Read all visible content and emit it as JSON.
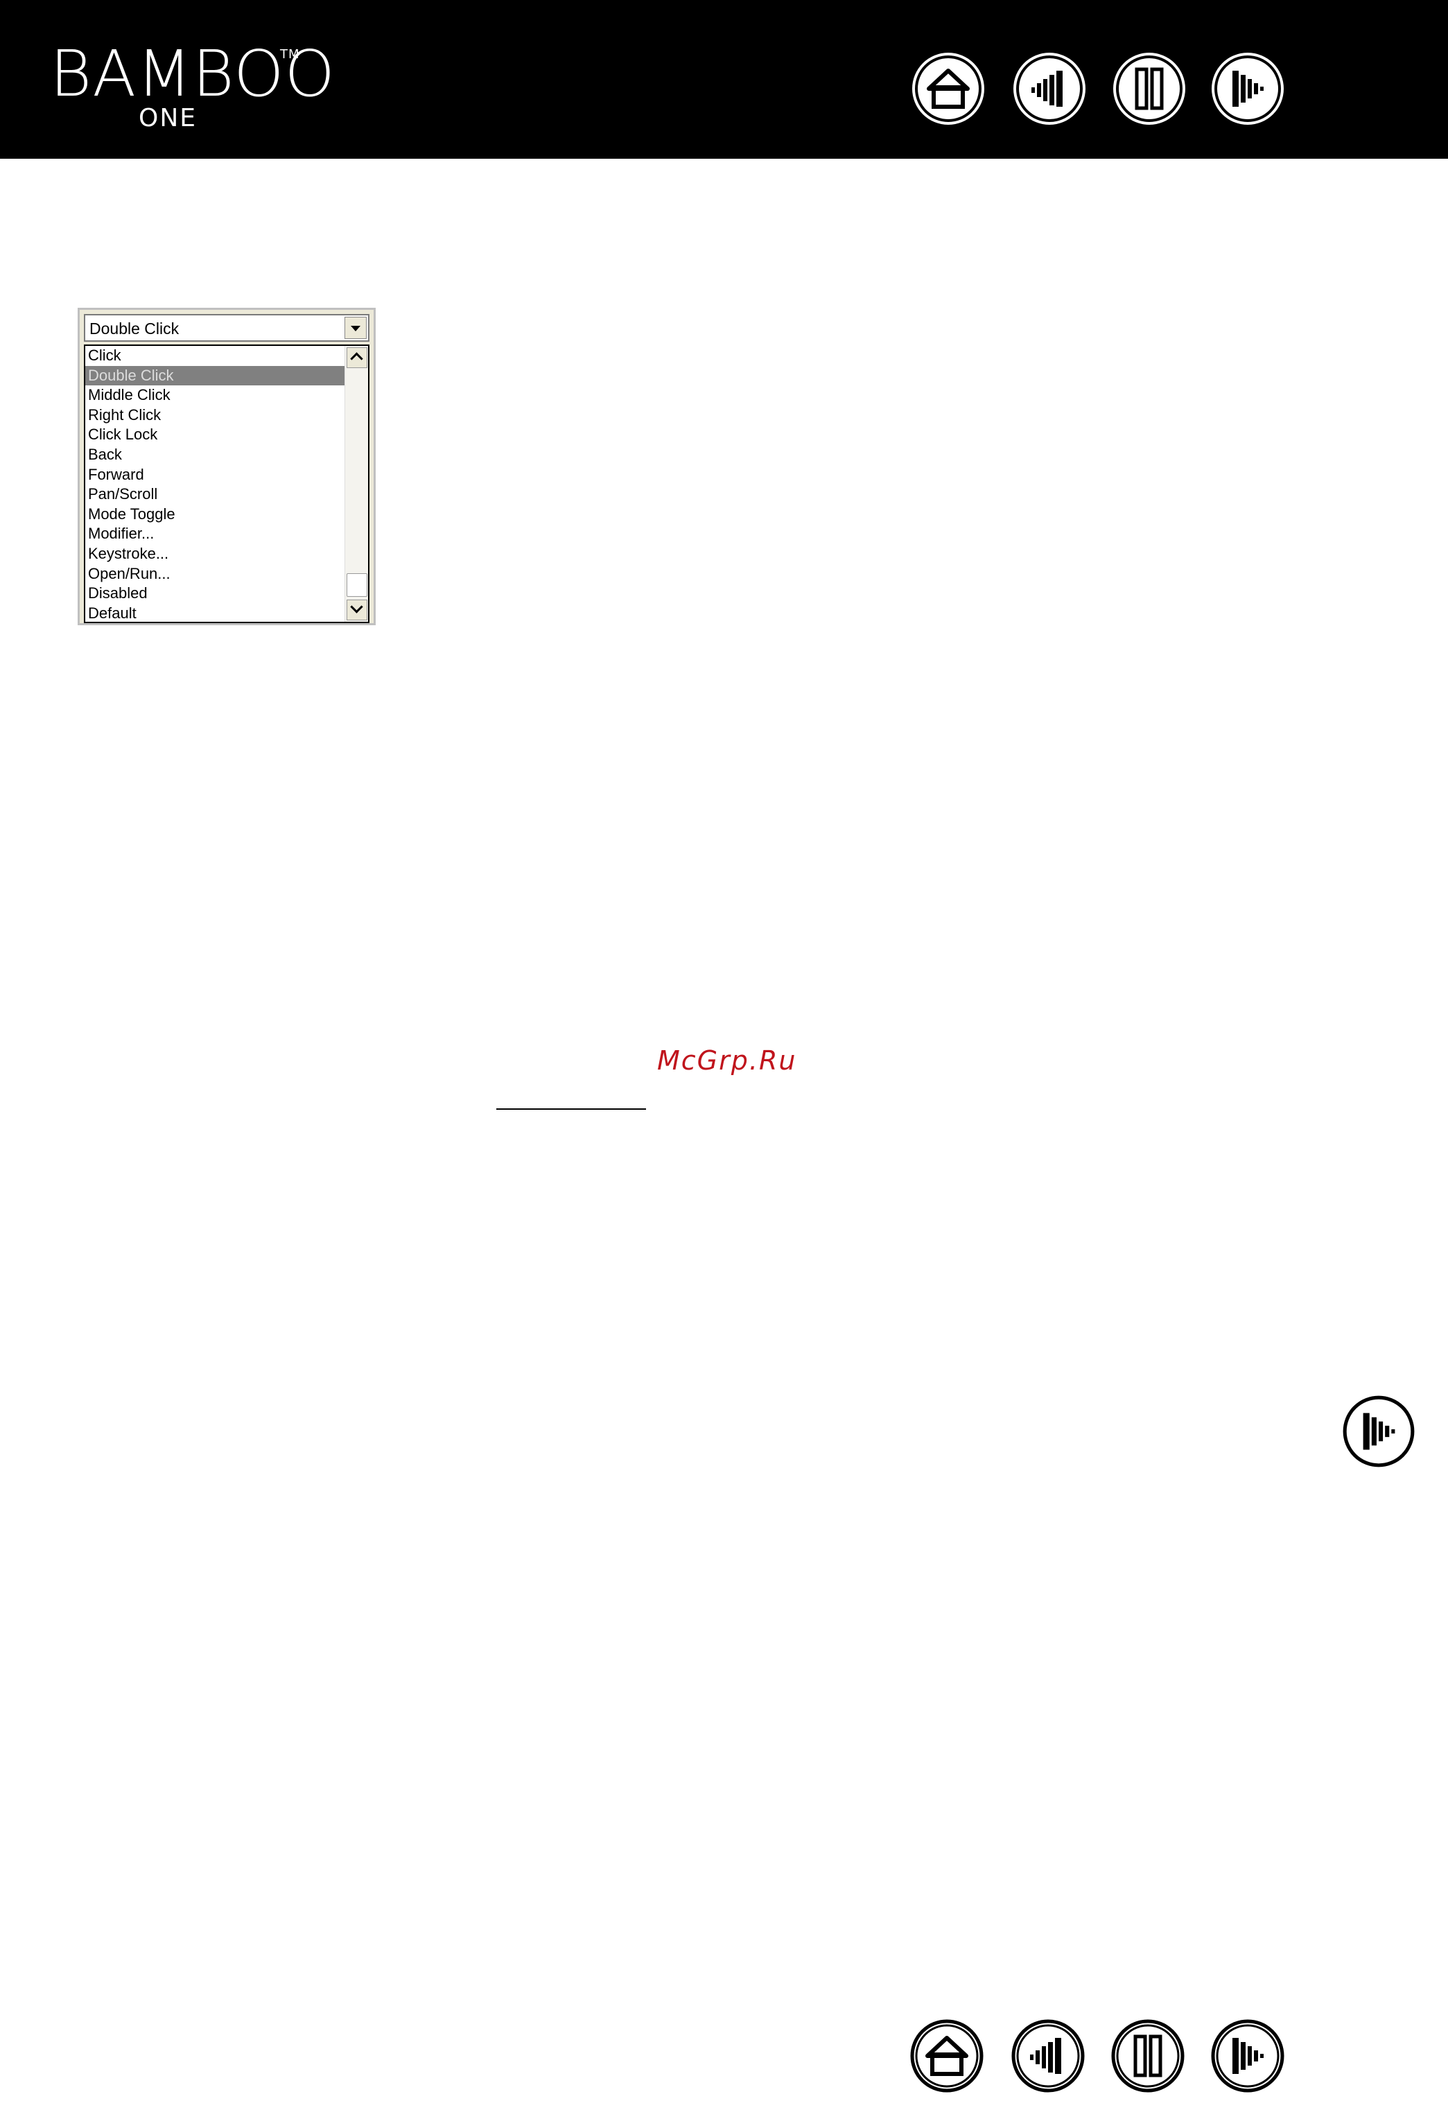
{
  "header": {
    "brand_name": "BAMBOO",
    "brand_tm": "TM",
    "brand_subtitle": "ONE",
    "nav_icons": [
      "home-icon",
      "contents-icon",
      "index-icon",
      "next-icon"
    ]
  },
  "dropdown": {
    "selected_value": "Double Click",
    "options": [
      "Click",
      "Double Click",
      "Middle Click",
      "Right Click",
      "Click Lock",
      "Back",
      "Forward",
      "Pan/Scroll",
      "Mode Toggle",
      "Modifier...",
      "Keystroke...",
      "Open/Run...",
      "Disabled",
      "Default"
    ],
    "highlighted_index": 1
  },
  "side_icon": "next-page-icon",
  "watermark": "McGrp.Ru",
  "footer": {
    "nav_icons": [
      "home-icon",
      "contents-icon",
      "index-icon",
      "next-icon"
    ]
  },
  "colors": {
    "header_bg": "#000000",
    "watermark": "#c0141c",
    "selection": "#808080"
  }
}
